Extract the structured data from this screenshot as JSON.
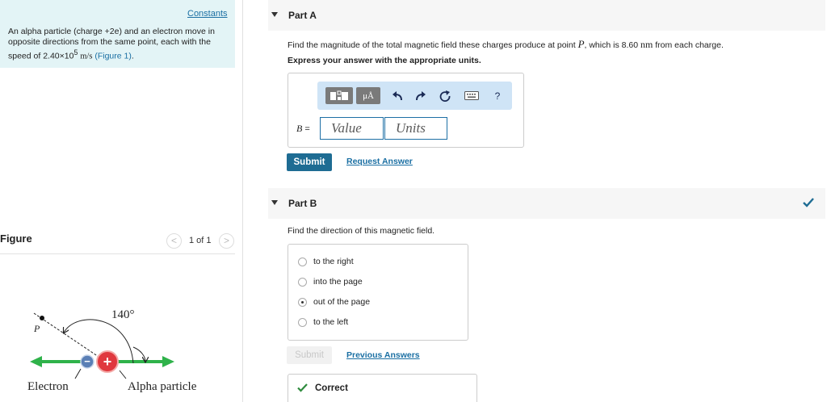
{
  "problem": {
    "constants_link": "Constants",
    "text_intro": "An alpha particle (charge +2e) and an electron move in opposite directions from the same point, each with the speed of 2.40×10",
    "exponent": "5",
    "unit": "m/s",
    "figure_link": "(Figure 1)",
    "period": "."
  },
  "figure": {
    "label": "Figure",
    "pager": "1 of 1",
    "prev_glyph": "<",
    "next_glyph": ">",
    "angle_label": "140°",
    "point_label": "P",
    "electron_label": "Electron",
    "alpha_label": "Alpha particle",
    "electron_sign": "−",
    "alpha_sign": "+"
  },
  "part_a": {
    "title": "Part A",
    "question_before": "Find the magnitude of the total magnetic field these charges produce at point ",
    "point": "P",
    "question_mid": ", which is 8.60 ",
    "distance_unit": "nm",
    "question_after": " from each charge.",
    "instruction": "Express your answer with the appropriate units.",
    "units_button": "μÅ",
    "help": "?",
    "variable": "B",
    "equals": " =",
    "value_placeholder": "Value",
    "units_placeholder": "Units",
    "submit": "Submit",
    "request_answer": "Request Answer"
  },
  "part_b": {
    "title": "Part B",
    "question": "Find the direction of this magnetic field.",
    "options": [
      {
        "label": "to the right",
        "selected": false
      },
      {
        "label": "into the page",
        "selected": false
      },
      {
        "label": "out of the page",
        "selected": true
      },
      {
        "label": "to the left",
        "selected": false
      }
    ],
    "submit": "Submit",
    "previous_answers": "Previous Answers",
    "feedback": "Correct"
  },
  "colors": {
    "accent": "#1e6c93",
    "link": "#1a6fa3",
    "correct_green": "#2e8b3d",
    "problem_bg": "#e3f4f6",
    "arrow_green": "#2fb24a",
    "alpha_red": "#e0383e",
    "electron_blue": "#5a7fb5"
  }
}
